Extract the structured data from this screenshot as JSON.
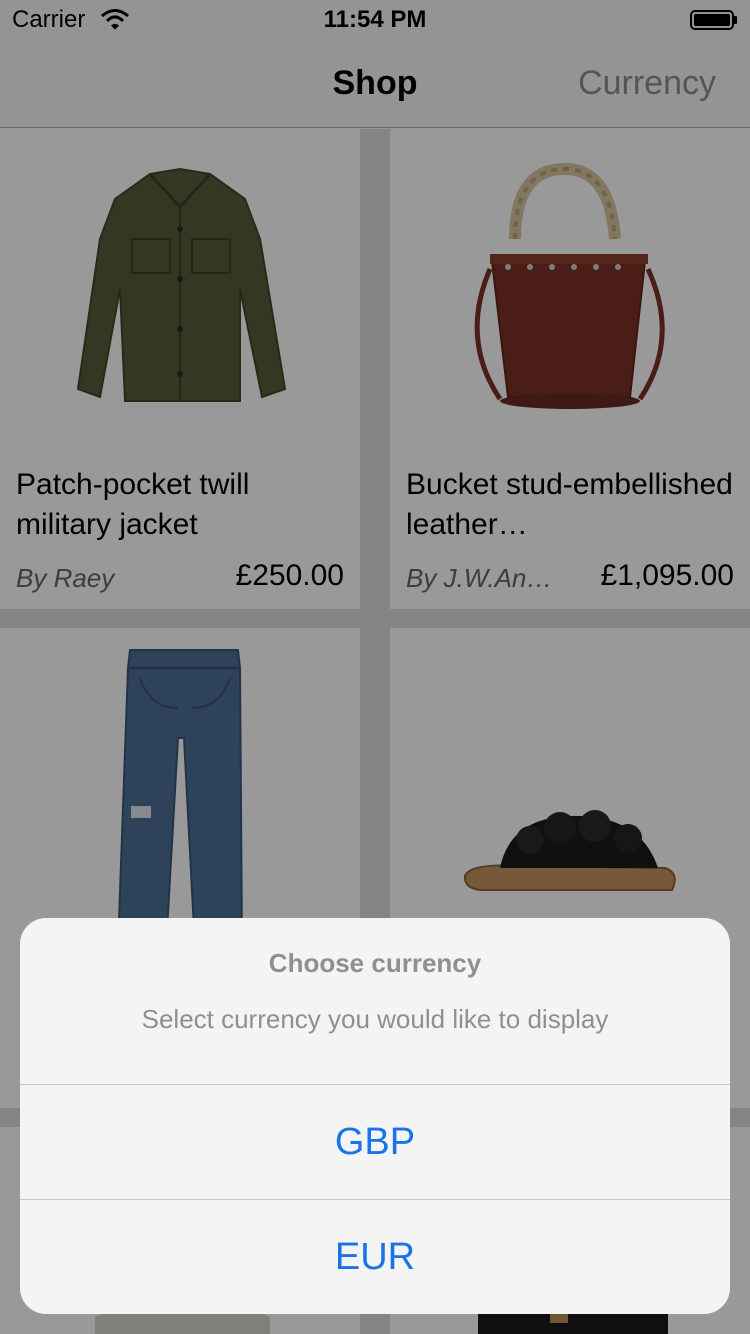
{
  "status_bar": {
    "carrier": "Carrier",
    "time": "11:54 PM",
    "wifi_icon": "wifi-icon",
    "battery_icon": "battery-icon"
  },
  "nav": {
    "title": "Shop",
    "right_button": "Currency"
  },
  "products": [
    {
      "title": "Patch-pocket twill military jacket",
      "brand": "By Raey",
      "price": "£250.00",
      "image": "olive-jacket"
    },
    {
      "title": " Bucket stud-embellished leather…",
      "brand": "By J.W.An…",
      "price": "£1,095.00",
      "image": "burgundy-bucket-bag"
    },
    {
      "title": "",
      "brand": "",
      "price": "",
      "image": "blue-flared-jeans"
    },
    {
      "title": "",
      "brand": "",
      "price": "",
      "image": "black-shearling-slide"
    }
  ],
  "action_sheet": {
    "title": "Choose currency",
    "message": "Select currency you would like to display",
    "options": [
      "GBP",
      "EUR"
    ]
  },
  "colors": {
    "accent": "#1a73e8",
    "nav_background": "#f7f7f7",
    "dim": "rgba(0,0,0,0.40)"
  }
}
